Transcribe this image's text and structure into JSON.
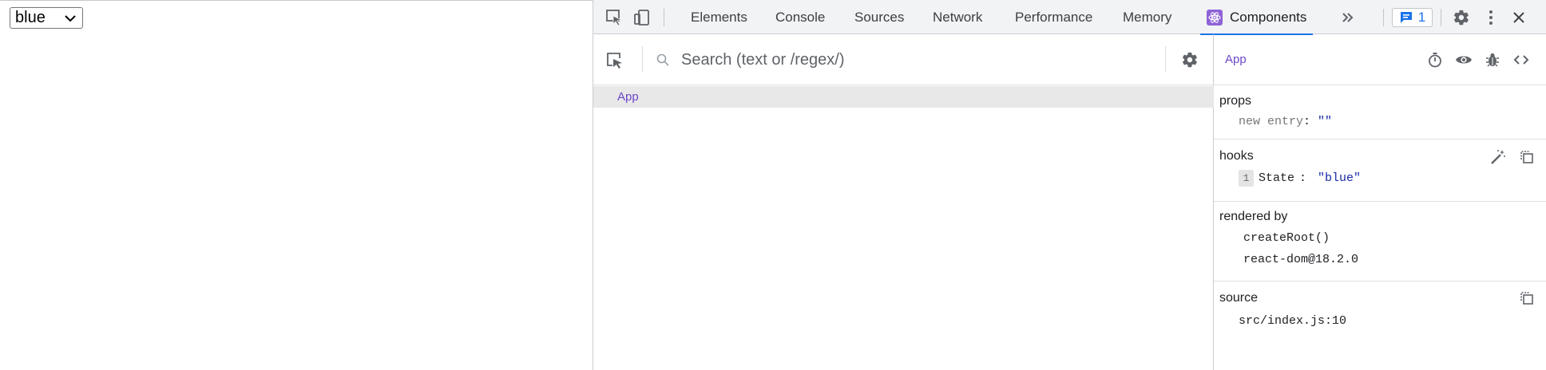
{
  "page": {
    "select_value": "blue"
  },
  "devtools": {
    "tabs": [
      "Elements",
      "Console",
      "Sources",
      "Network",
      "Performance",
      "Memory",
      "Components"
    ],
    "active_tab": "Components",
    "issues_count": "1",
    "search_placeholder": "Search (text or /regex/)",
    "tree": {
      "selected_component": "App"
    },
    "inspector": {
      "component_name": "App",
      "props": {
        "title": "props",
        "key": "new entry",
        "value": "\"\""
      },
      "hooks": {
        "title": "hooks",
        "index": "1",
        "key": "State",
        "value": "\"blue\""
      },
      "rendered_by": {
        "title": "rendered by",
        "items": [
          "createRoot()",
          "react-dom@18.2.0"
        ]
      },
      "source": {
        "title": "source",
        "value": "src/index.js:10"
      }
    },
    "colors": {
      "accent": "#1a73e8",
      "component_name": "#6b47c9",
      "string_value": "#1a2aa6",
      "toolbar_bg": "#f1f3f4"
    },
    "icons": [
      "inspect-element-icon",
      "device-toolbar-icon",
      "react-icon",
      "more-tabs-icon",
      "issues-icon",
      "settings-gear-icon",
      "kebab-menu-icon",
      "close-icon",
      "search-icon",
      "stopwatch-icon",
      "eye-icon",
      "bug-icon",
      "code-icon",
      "wand-icon",
      "copy-icon"
    ]
  }
}
